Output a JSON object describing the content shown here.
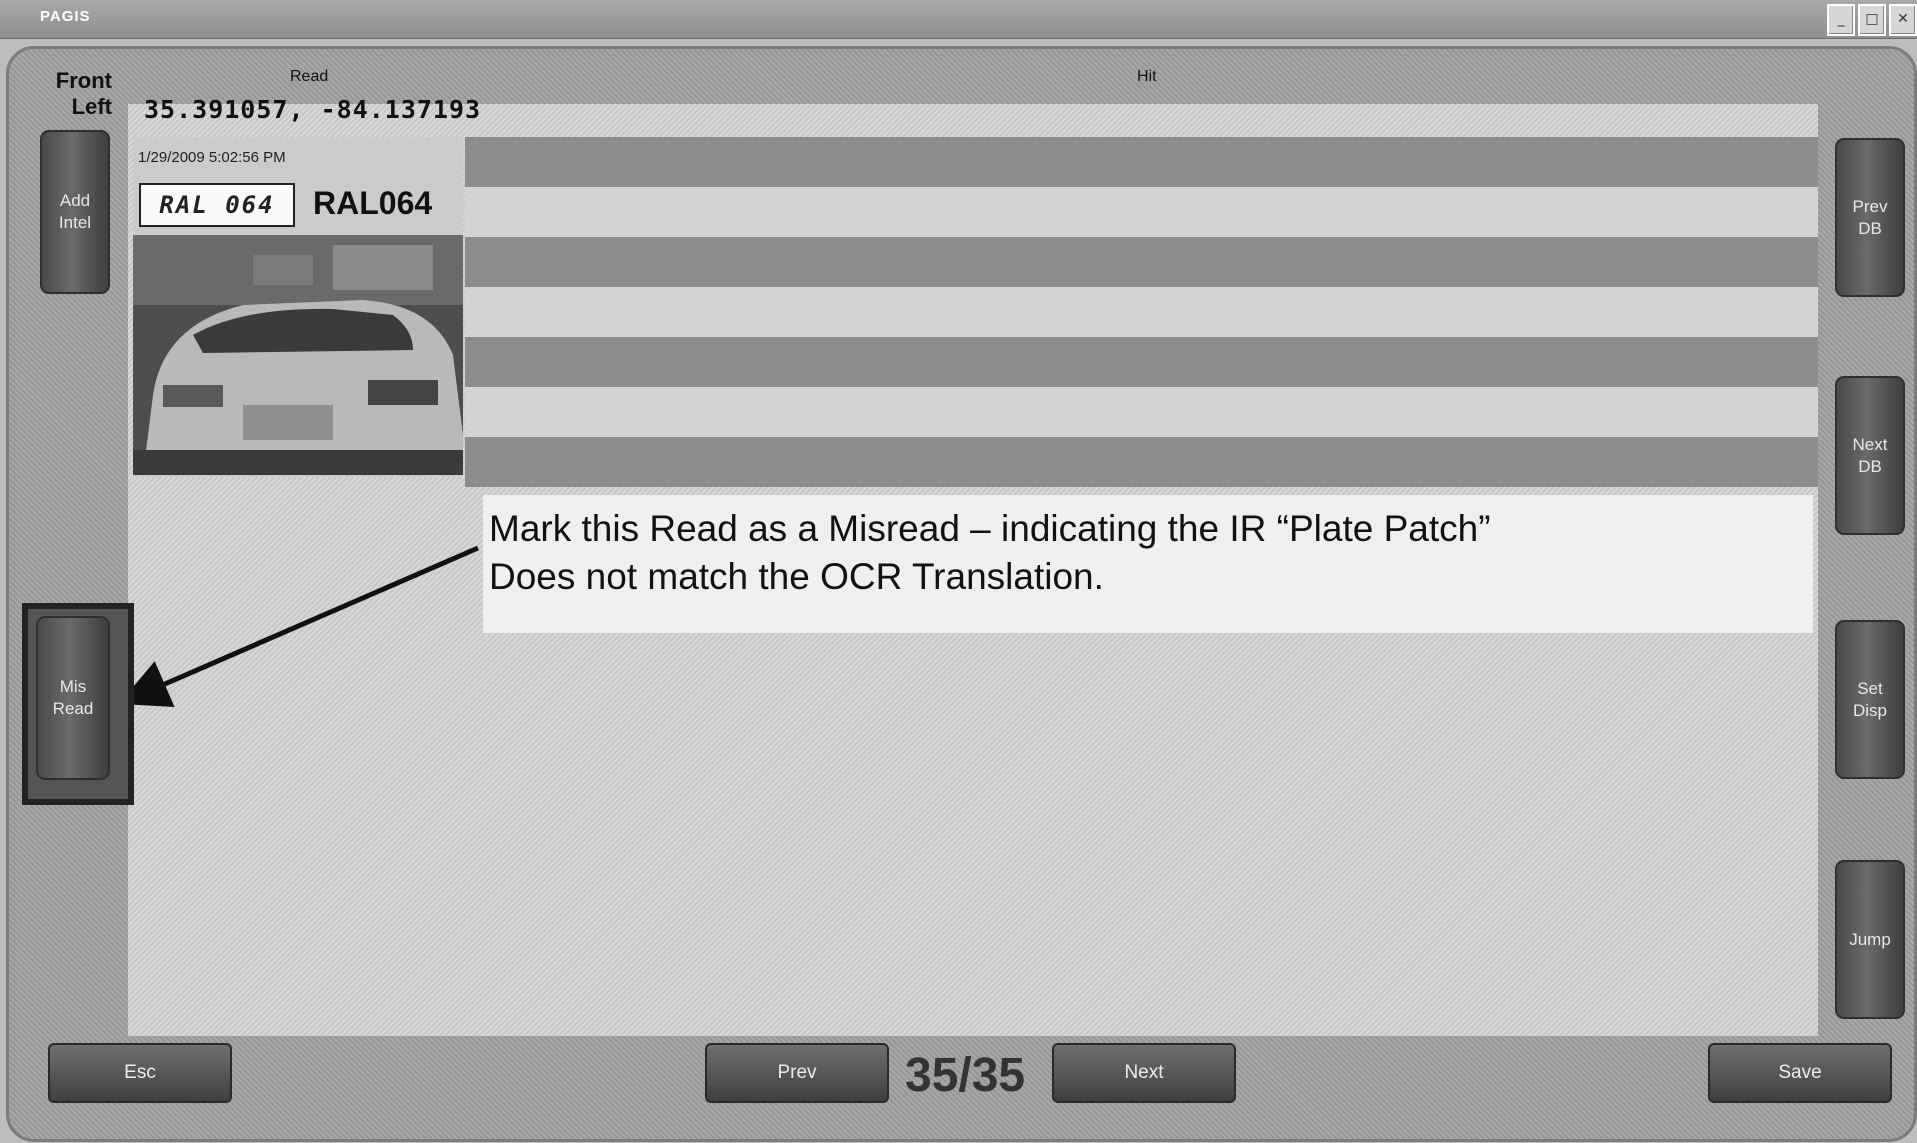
{
  "window": {
    "title": "PAGIS",
    "minimize": "_",
    "maximize": "□",
    "close": "✕"
  },
  "header": {
    "camera_line1": "Front",
    "camera_line2": "Left",
    "read_label": "Read",
    "hit_label": "Hit",
    "coordinates": "35.391057, -84.137193"
  },
  "read": {
    "timestamp": "1/29/2009 5:02:56 PM",
    "plate_crop_text": "RAL 064",
    "plate_ocr": "RAL064"
  },
  "callout": {
    "line1": "Mark this Read as a Misread – indicating the IR “Plate Patch”",
    "line2": "Does not match the OCR Translation."
  },
  "left_buttons": {
    "add_intel_1": "Add",
    "add_intel_2": "Intel",
    "misread_1": "Mis",
    "misread_2": "Read"
  },
  "right_buttons": {
    "prev_db_1": "Prev",
    "prev_db_2": "DB",
    "next_db_1": "Next",
    "next_db_2": "DB",
    "set_disp_1": "Set",
    "set_disp_2": "Disp",
    "jump": "Jump"
  },
  "bottom": {
    "esc": "Esc",
    "prev": "Prev",
    "counter": "35/35",
    "next": "Next",
    "save": "Save"
  }
}
